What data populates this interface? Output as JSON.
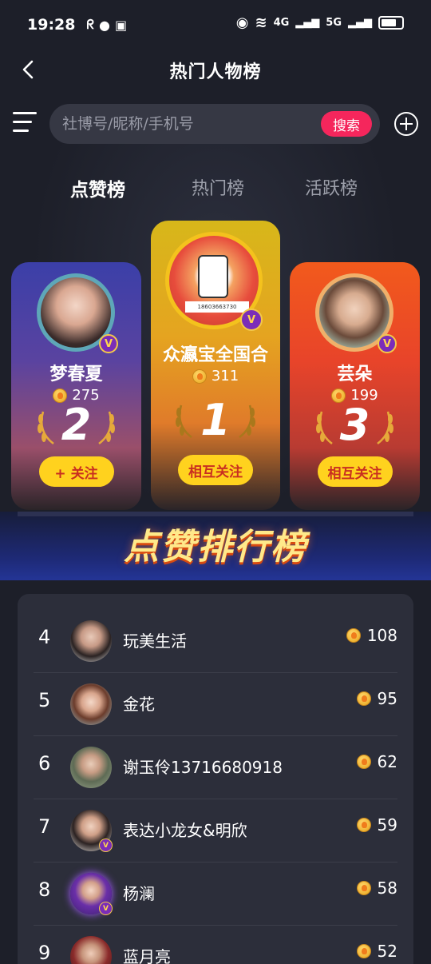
{
  "status": {
    "time": "19:28",
    "net1": "4G",
    "net2": "5G"
  },
  "nav": {
    "title": "热门人物榜"
  },
  "search": {
    "placeholder": "社博号/昵称/手机号",
    "button": "搜索"
  },
  "tabs": [
    {
      "label": "点赞榜",
      "active": true
    },
    {
      "label": "热门榜",
      "active": false
    },
    {
      "label": "活跃榜",
      "active": false
    }
  ],
  "podium": [
    {
      "rank": "2",
      "name": "梦春夏",
      "score": "275",
      "button": "+ 关注"
    },
    {
      "rank": "1",
      "name": "众瀛宝全国合",
      "score": "311",
      "button": "相互关注",
      "avatar_text": "18603663730"
    },
    {
      "rank": "3",
      "name": "芸朵",
      "score": "199",
      "button": "相互关注"
    }
  ],
  "banner": "点赞排行榜",
  "list": [
    {
      "rank": "4",
      "name": "玩美生活",
      "score": "108"
    },
    {
      "rank": "5",
      "name": "金花",
      "score": "95"
    },
    {
      "rank": "6",
      "name": "谢玉伶13716680918",
      "score": "62"
    },
    {
      "rank": "7",
      "name": "表达小龙女&明欣",
      "score": "59"
    },
    {
      "rank": "8",
      "name": "杨澜",
      "score": "58"
    },
    {
      "rank": "9",
      "name": "蓝月亮",
      "score": "52"
    }
  ],
  "colors": {
    "accent": "#f5265c",
    "button_yellow": "#ffd21e",
    "background": "#1d1f29"
  }
}
